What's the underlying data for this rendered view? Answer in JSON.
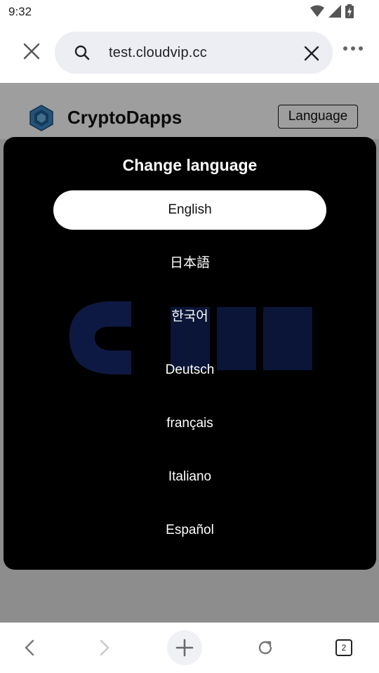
{
  "status_bar": {
    "time": "9:32",
    "icons": [
      "wifi-icon",
      "signal-icon",
      "battery-icon"
    ]
  },
  "browser": {
    "url": "test.cloudvip.cc",
    "icons": {
      "close": "close-icon",
      "search": "search-icon",
      "clear": "clear-icon",
      "menu": "more-icon"
    }
  },
  "site": {
    "name": "CryptoDapps",
    "language_button": "Language"
  },
  "modal": {
    "title": "Change language",
    "languages": [
      "English",
      "日本語",
      "한국어",
      "Deutsch",
      "français",
      "Italiano",
      "Español"
    ],
    "selected": "English"
  },
  "toolbar": {
    "tab_count": "2",
    "icons": [
      "back-icon",
      "forward-icon",
      "new-tab-icon",
      "reload-icon",
      "tabs-icon"
    ]
  },
  "colors": {
    "modal_bg": "#000000",
    "selected_bg": "#ffffff",
    "url_field_bg": "#eceef3",
    "logo_blue": "#2b6fa8"
  }
}
